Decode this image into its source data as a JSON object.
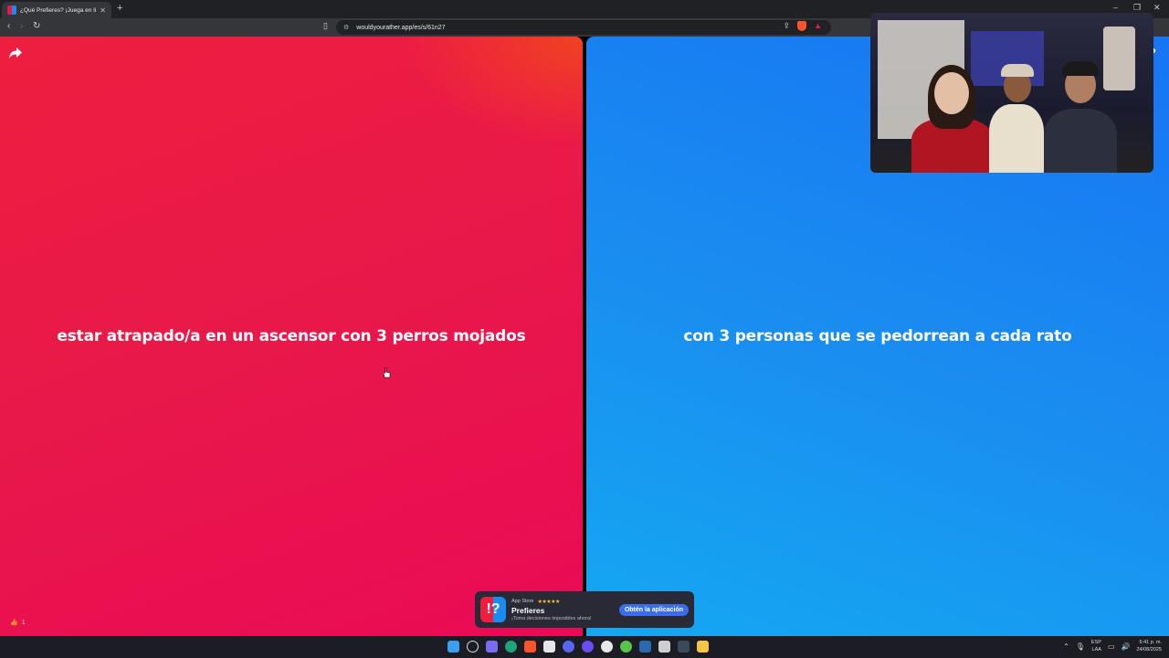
{
  "browser": {
    "tab_title": "¿Qué Prefieres? ¡Juega en línea!",
    "url": "wouldyourather.app/es/s/61n27"
  },
  "question": {
    "option_a": "estar atrapado/a en un ascensor con 3 perros mojados",
    "option_b": "con 3 personas que se pedorrean a cada rato",
    "option_a_color": "#e8184a",
    "option_b_color": "#1a8cf0",
    "likes": "1",
    "help_label": "?"
  },
  "app_banner": {
    "store_label": "App Store",
    "rating_stars": "★★★★★",
    "app_name": "Prefieres",
    "tagline": "¡Toma decisiones imposibles ahora!",
    "cta_label": "Obtén la aplicación"
  },
  "taskbar": {
    "lang_top": "ESP",
    "lang_bottom": "LAA",
    "time": "6:41 p. m.",
    "date": "24/08/2025"
  }
}
